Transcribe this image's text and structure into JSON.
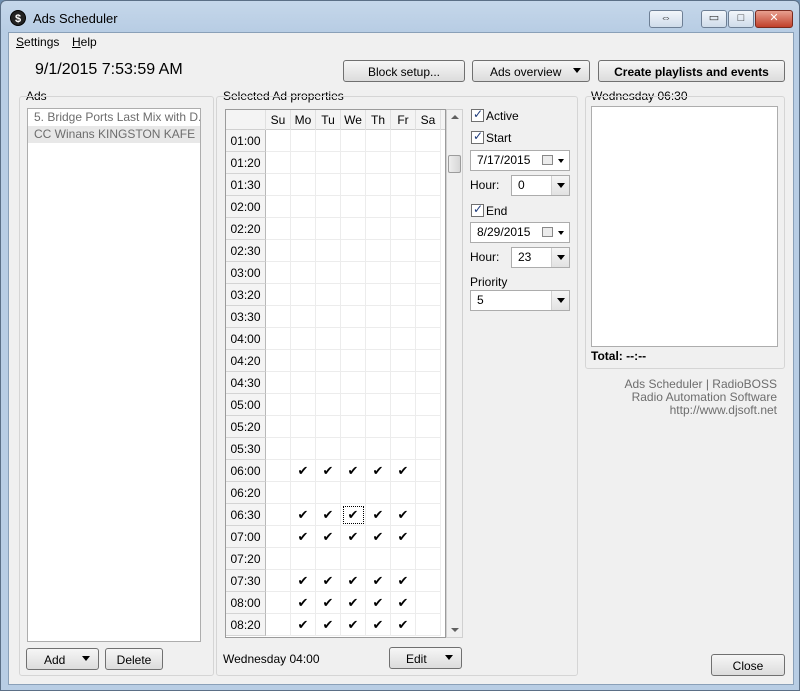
{
  "window": {
    "title": "Ads Scheduler",
    "app_icon": "$",
    "controls": {
      "restore_glyph": "⇔",
      "minimize_glyph": "▭",
      "maximize_glyph": "□",
      "close_glyph": "✕"
    }
  },
  "menu": [
    {
      "label": "Settings",
      "mnemonic": "S"
    },
    {
      "label": "Help",
      "mnemonic": "H"
    }
  ],
  "clock": "9/1/2015 7:53:59 AM",
  "toolbar": {
    "block_setup": "Block setup...",
    "ads_overview": "Ads overview",
    "create_playlists": "Create playlists and events"
  },
  "ads": {
    "label": "Ads",
    "items": [
      {
        "label": "5. Bridge Ports Last Mix with D..."
      },
      {
        "label": "CC Winans KINGSTON KAFE"
      }
    ],
    "add_label": "Add",
    "delete_label": "Delete"
  },
  "schedule": {
    "label": "Selected Ad properties",
    "days": [
      "Su",
      "Mo",
      "Tu",
      "We",
      "Th",
      "Fr",
      "Sa"
    ],
    "rows": [
      {
        "time": "01:00",
        "marks": [
          0,
          0,
          0,
          0,
          0,
          0,
          0
        ]
      },
      {
        "time": "01:20",
        "marks": [
          0,
          0,
          0,
          0,
          0,
          0,
          0
        ]
      },
      {
        "time": "01:30",
        "marks": [
          0,
          0,
          0,
          0,
          0,
          0,
          0
        ]
      },
      {
        "time": "02:00",
        "marks": [
          0,
          0,
          0,
          0,
          0,
          0,
          0
        ]
      },
      {
        "time": "02:20",
        "marks": [
          0,
          0,
          0,
          0,
          0,
          0,
          0
        ]
      },
      {
        "time": "02:30",
        "marks": [
          0,
          0,
          0,
          0,
          0,
          0,
          0
        ]
      },
      {
        "time": "03:00",
        "marks": [
          0,
          0,
          0,
          0,
          0,
          0,
          0
        ]
      },
      {
        "time": "03:20",
        "marks": [
          0,
          0,
          0,
          0,
          0,
          0,
          0
        ]
      },
      {
        "time": "03:30",
        "marks": [
          0,
          0,
          0,
          0,
          0,
          0,
          0
        ]
      },
      {
        "time": "04:00",
        "marks": [
          0,
          0,
          0,
          0,
          0,
          0,
          0
        ]
      },
      {
        "time": "04:20",
        "marks": [
          0,
          0,
          0,
          0,
          0,
          0,
          0
        ]
      },
      {
        "time": "04:30",
        "marks": [
          0,
          0,
          0,
          0,
          0,
          0,
          0
        ]
      },
      {
        "time": "05:00",
        "marks": [
          0,
          0,
          0,
          0,
          0,
          0,
          0
        ]
      },
      {
        "time": "05:20",
        "marks": [
          0,
          0,
          0,
          0,
          0,
          0,
          0
        ]
      },
      {
        "time": "05:30",
        "marks": [
          0,
          0,
          0,
          0,
          0,
          0,
          0
        ]
      },
      {
        "time": "06:00",
        "marks": [
          0,
          1,
          1,
          1,
          1,
          1,
          0
        ]
      },
      {
        "time": "06:20",
        "marks": [
          0,
          0,
          0,
          0,
          0,
          0,
          0
        ]
      },
      {
        "time": "06:30",
        "marks": [
          0,
          1,
          1,
          1,
          1,
          1,
          0
        ]
      },
      {
        "time": "07:00",
        "marks": [
          0,
          1,
          1,
          1,
          1,
          1,
          0
        ]
      },
      {
        "time": "07:20",
        "marks": [
          0,
          0,
          0,
          0,
          0,
          0,
          0
        ]
      },
      {
        "time": "07:30",
        "marks": [
          0,
          1,
          1,
          1,
          1,
          1,
          0
        ]
      },
      {
        "time": "08:00",
        "marks": [
          0,
          1,
          1,
          1,
          1,
          1,
          0
        ]
      },
      {
        "time": "08:20",
        "marks": [
          0,
          1,
          1,
          1,
          1,
          1,
          0
        ]
      }
    ],
    "check_glyph": "✔",
    "focused": {
      "row": "06:30",
      "day": "We"
    },
    "status": "Wednesday 04:00",
    "edit_label": "Edit"
  },
  "properties": {
    "active_label": "Active",
    "active": true,
    "start_label": "Start",
    "start_enabled": true,
    "start_date": "7/17/2015",
    "start_hour_label": "Hour:",
    "start_hour": "0",
    "end_label": "End",
    "end_enabled": true,
    "end_date": "8/29/2015",
    "end_hour_label": "Hour:",
    "end_hour": "23",
    "priority_label": "Priority",
    "priority": "5"
  },
  "preview": {
    "label": "Wednesday 06:30",
    "total": "Total: --:--"
  },
  "about": {
    "line1": "Ads Scheduler | RadioBOSS",
    "line2": "Radio Automation Software",
    "line3": "http://www.djsoft.net"
  },
  "close_label": "Close"
}
